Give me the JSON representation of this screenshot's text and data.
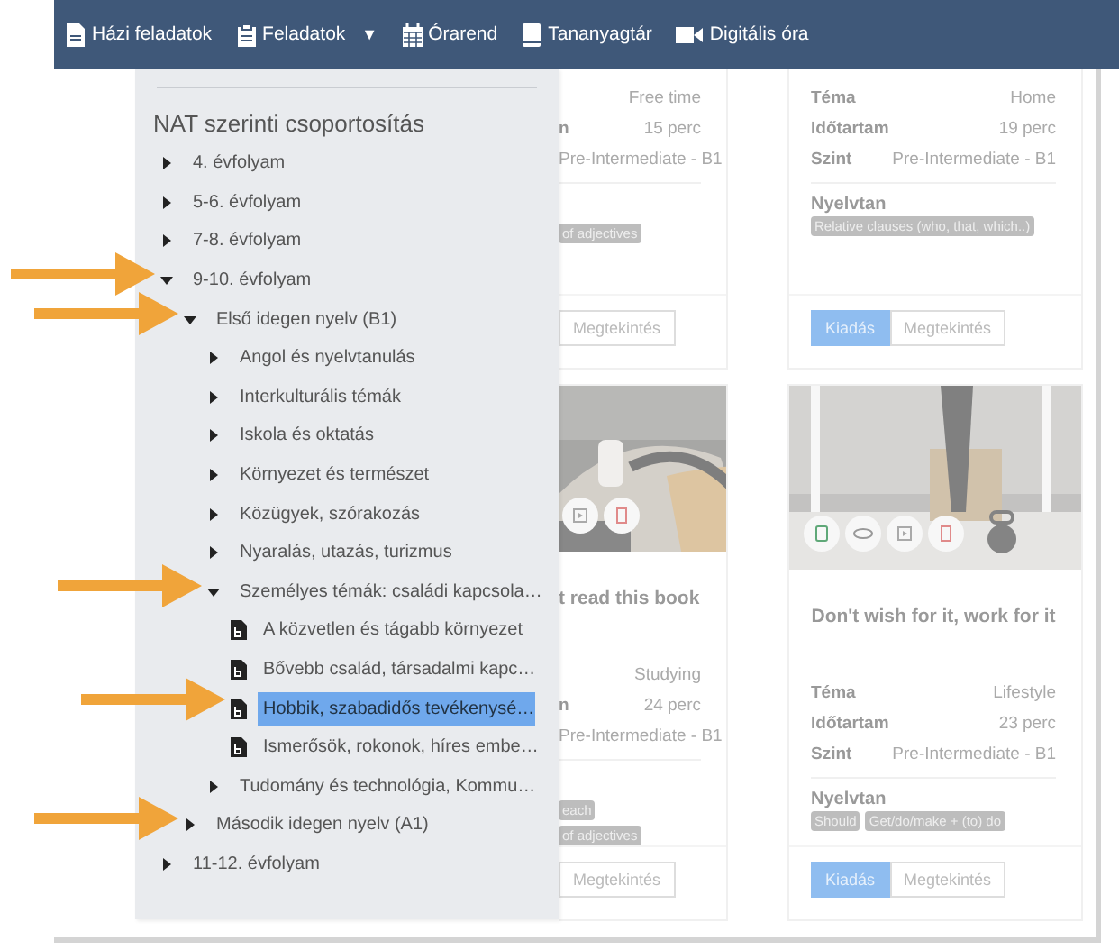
{
  "nav": {
    "items": [
      {
        "kind": "document",
        "label": "Házi feladatok"
      },
      {
        "kind": "clipboard",
        "label": "Feladatok",
        "caret": "▼"
      },
      {
        "kind": "calendar",
        "label": "Órarend"
      },
      {
        "kind": "book",
        "label": "Tananyagtár"
      },
      {
        "kind": "video",
        "label": "Digitális óra"
      }
    ]
  },
  "cards": [
    {
      "fields": [
        {
          "value": "Free time"
        },
        {
          "label": "n",
          "value": "15 perc"
        },
        {
          "value": "Pre-Intermediate - B1"
        }
      ],
      "tags": [
        "of adjectives"
      ],
      "buttons": [
        {
          "label": "Megtekintés",
          "selected": false
        }
      ]
    },
    {
      "fields": [
        {
          "label": "Téma",
          "value": "Home"
        },
        {
          "label": "Időtartam",
          "value": "19 perc"
        },
        {
          "label": "Szint",
          "value": "Pre-Intermediate - B1"
        }
      ],
      "grammar_label": "Nyelvtan",
      "tags": [
        "Relative clauses (who, that, which..)"
      ],
      "buttons": [
        {
          "label": "Kiadás",
          "selected": true
        },
        {
          "label": "Megtekintés",
          "selected": false
        }
      ]
    },
    {
      "image": {
        "kind": "picture",
        "picture_buttons": [
          {
            "kind": "play"
          },
          {
            "kind": "delete"
          }
        ]
      },
      "title": "t read this book",
      "fields": [
        {
          "value": "Studying"
        },
        {
          "label": "n",
          "value": "24 perc"
        },
        {
          "value": "Pre-Intermediate - B1"
        }
      ],
      "tags": [
        "each",
        "of adjectives"
      ],
      "buttons": [
        {
          "label": "Megtekintés",
          "selected": false
        }
      ]
    },
    {
      "image": {
        "kind": "picture",
        "picture_buttons": [
          {
            "kind": "copy"
          },
          {
            "kind": "view"
          },
          {
            "kind": "play"
          },
          {
            "kind": "delete"
          }
        ]
      },
      "title": "Don't wish for it, work for it",
      "fields": [
        {
          "label": "Téma",
          "value": "Lifestyle"
        },
        {
          "label": "Időtartam",
          "value": "23 perc"
        },
        {
          "label": "Szint",
          "value": "Pre-Intermediate - B1"
        }
      ],
      "grammar_label": "Nyelvtan",
      "tags": [
        "Should",
        "Get/do/make + (to) do"
      ],
      "buttons": [
        {
          "label": "Kiadás",
          "selected": true
        },
        {
          "label": "Megtekintés",
          "selected": false
        }
      ]
    }
  ],
  "dropdown": {
    "title": "NAT szerinti csoportosítás",
    "tree": [
      {
        "label": "4. évfolyam",
        "expanded": false,
        "marked": false
      },
      {
        "label": "5-6. évfolyam",
        "expanded": false,
        "marked": false
      },
      {
        "label": "7-8. évfolyam",
        "expanded": false,
        "marked": false
      },
      {
        "label": "9-10. évfolyam",
        "expanded": true,
        "marked": true,
        "children": [
          {
            "label": "Első idegen nyelv (B1)",
            "expanded": true,
            "marked": true,
            "children": [
              {
                "label": "Angol és nyelvtanulás",
                "expanded": false,
                "marked": false
              },
              {
                "label": "Interkulturális témák",
                "expanded": false,
                "marked": false
              },
              {
                "label": "Iskola és oktatás",
                "expanded": false,
                "marked": false
              },
              {
                "label": "Környezet és természet",
                "expanded": false,
                "marked": false
              },
              {
                "label": "Közügyek, szórakozás",
                "expanded": false,
                "marked": false
              },
              {
                "label": "Nyaralás, utazás, turizmus",
                "expanded": false,
                "marked": false
              },
              {
                "label": "Személyes témák: családi kapcsola…",
                "expanded": true,
                "marked": true,
                "children": [
                  {
                    "kind": "document",
                    "label": "A közvetlen és tágabb környezet",
                    "selected": false,
                    "marked": false
                  },
                  {
                    "kind": "document",
                    "label": "Bővebb család, társadalmi kapc…",
                    "selected": false,
                    "marked": false
                  },
                  {
                    "kind": "document",
                    "label": "Hobbik, szabadidős tevékenysé…",
                    "selected": true,
                    "marked": true
                  },
                  {
                    "kind": "document",
                    "label": "Ismerősök, rokonok, híres embe…",
                    "selected": false,
                    "marked": false
                  }
                ]
              },
              {
                "label": "Tudomány és technológia, Kommu…",
                "expanded": false,
                "marked": false
              }
            ]
          },
          {
            "label": "Második idegen nyelv (A1)",
            "expanded": false,
            "marked": true
          }
        ]
      },
      {
        "label": "11-12. évfolyam",
        "expanded": false,
        "marked": false
      }
    ]
  }
}
